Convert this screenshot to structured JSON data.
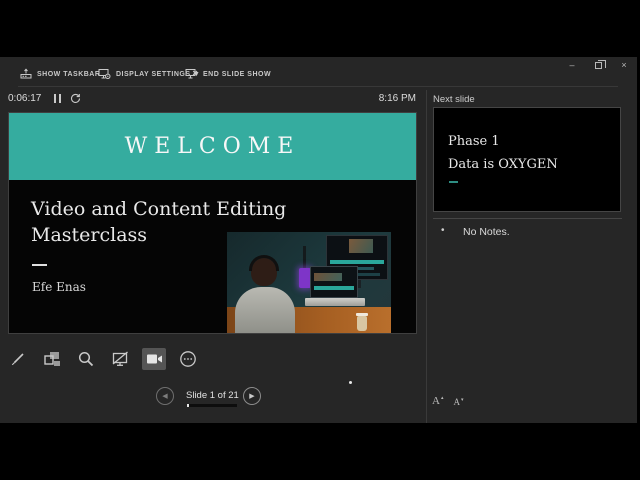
{
  "colors": {
    "accent_teal": "#35ac9f",
    "window_bg": "#262626",
    "slide_bg": "#050505",
    "preview_dash_teal": "#2e8d82"
  },
  "window_controls": {
    "minimize": "–",
    "close": "×"
  },
  "top_toolbar": {
    "items": [
      {
        "label": "SHOW TASKBAR"
      },
      {
        "label": "DISPLAY SETTINGS ▼"
      },
      {
        "label": "END SLIDE SHOW"
      }
    ]
  },
  "status_bar": {
    "timer": "0:06:17",
    "clock": "8:16 PM"
  },
  "slide": {
    "banner": "WELCOME",
    "title_line1": "Video and Content Editing",
    "title_line2": "Masterclass",
    "author": "Efe Enas"
  },
  "next_slide_panel": {
    "label": "Next slide",
    "preview": {
      "line1": "Phase 1",
      "line2": "Data is OXYGEN"
    }
  },
  "notes": {
    "bullet": "•",
    "text": "No Notes."
  },
  "navigation": {
    "label": "Slide 1 of 21",
    "current": 1,
    "total": 21,
    "prev_glyph": "◀",
    "next_glyph": "▶"
  },
  "font_controls": {
    "increase_label": "A",
    "decrease_label": "A",
    "up_glyph": "▴",
    "down_glyph": "▾"
  }
}
